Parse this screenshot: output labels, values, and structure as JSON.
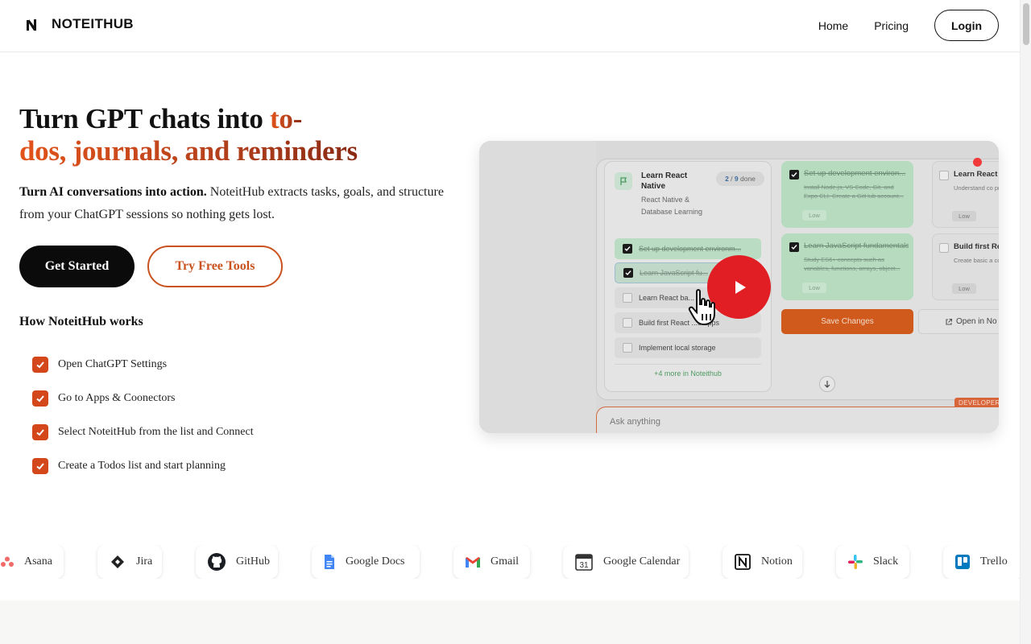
{
  "brand": {
    "name": "NOTEITHUB"
  },
  "nav": {
    "home": "Home",
    "pricing": "Pricing",
    "login": "Login"
  },
  "hero": {
    "headline_plain": "Turn GPT chats into ",
    "headline_accent_1": "to-",
    "headline_accent_2": "dos, journals, and reminders",
    "subhead_bold": "Turn AI conversations into action.",
    "subhead_line1_rest": " NoteitHub extracts tasks, goals, and structure",
    "subhead_line2": "from your ChatGPT sessions so nothing gets lost.",
    "cta_primary": "Get Started",
    "cta_secondary": "Try Free Tools"
  },
  "how": {
    "title": "How NoteitHub works",
    "steps": [
      "Open ChatGPT Settings",
      "Go to Apps & Coonectors",
      "Select NoteitHub from the list and Connect",
      "Create a Todos list and start planning"
    ]
  },
  "video": {
    "card_title": "Learn React Native",
    "card_subtitle": "React Native & Database Learning",
    "done_count": "2",
    "done_total": "9",
    "done_label": "done",
    "tasks": [
      {
        "label": "Set up development environm...",
        "checked": true
      },
      {
        "label": "Learn JavaScript fu...",
        "checked": true
      },
      {
        "label": "Learn React ba...",
        "checked": false
      },
      {
        "label": "Build first React ...e apps",
        "checked": false
      },
      {
        "label": "Implement local storage",
        "checked": false
      }
    ],
    "more": "+4 more in Noteithub",
    "detail_1_title": "Set up development environ...",
    "detail_1_desc": "Install Node.js, VS Code, Git, and Expo CLI. Create a GitHub account...",
    "detail_2_title": "Learn JavaScript fundamentals",
    "detail_2_desc": "Study ES6+ concepts such as variables, functions, arrays, object...",
    "priority": "Low",
    "side_1_title": "Learn React",
    "side_1_desc": "Understand co props, state, u",
    "side_2_title": "Build first Re",
    "side_2_desc": "Create basic a components, s",
    "save": "Save Changes",
    "open": "Open in No",
    "dev_tag": "DEVELOPER",
    "ask_placeholder": "Ask anything"
  },
  "integrations": [
    "Asana",
    "Jira",
    "GitHub",
    "Google Docs",
    "Gmail",
    "Google Calendar",
    "Notion",
    "Slack",
    "Trello"
  ],
  "colors": {
    "accent": "#d1571f",
    "primary": "#0b0b0b",
    "play": "#e01e24",
    "check": "#d3471a"
  }
}
